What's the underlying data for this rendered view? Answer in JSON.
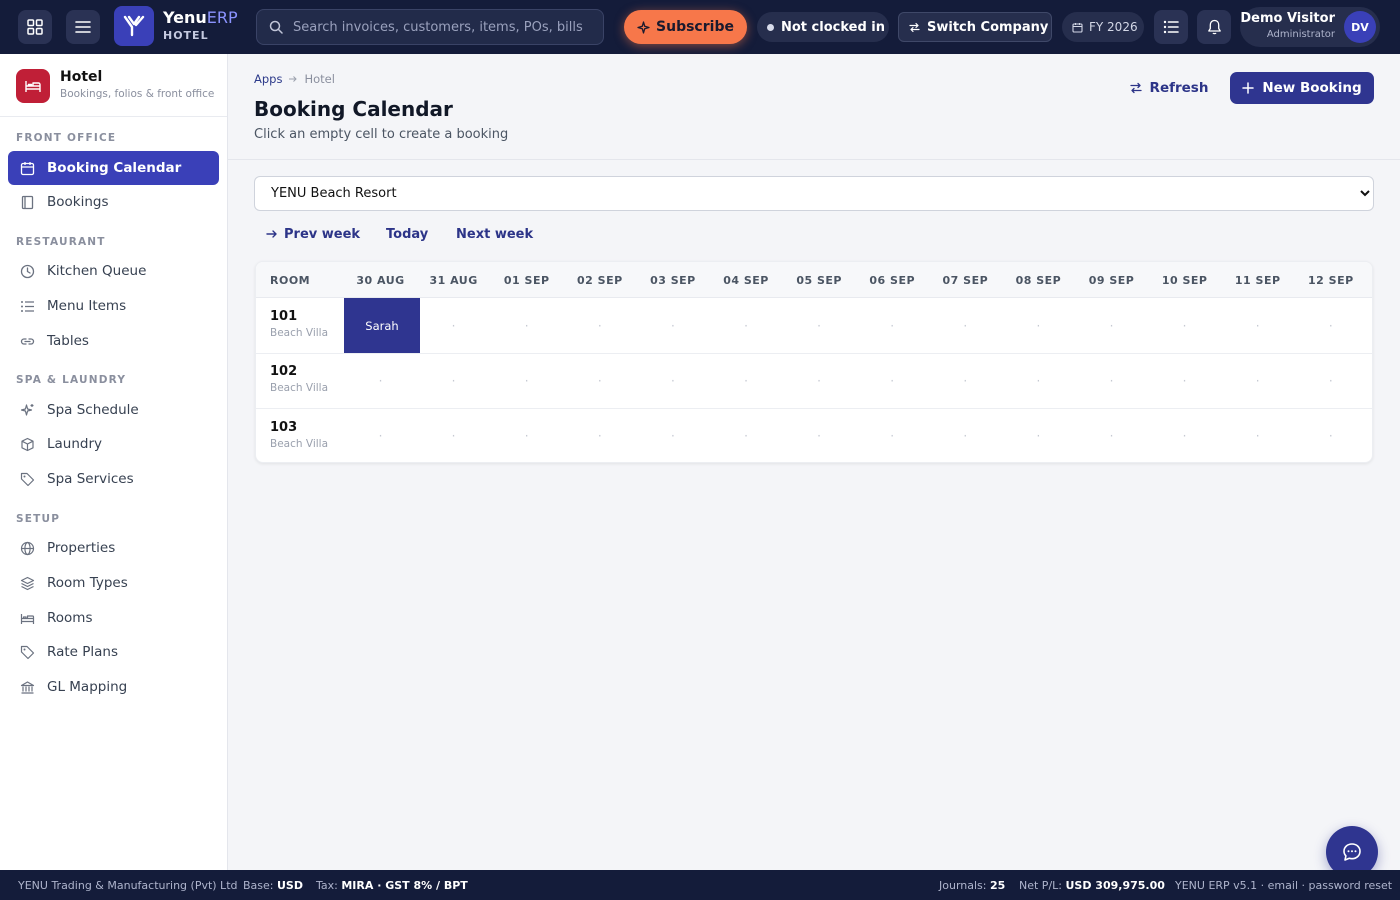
{
  "topbar": {
    "brand_name": "Yenu",
    "brand_accent": "ERP",
    "brand_sub": "HOTEL",
    "search_placeholder": "Search invoices, customers, items, POs, bills…",
    "subscribe_label": "Subscribe",
    "clock_status": "Not clocked in",
    "switch_company_label": "Switch Company",
    "fiscal_year": "FY 2026",
    "user_name": "Demo Visitor",
    "user_role": "Administrator",
    "user_initials": "DV"
  },
  "sidebar": {
    "module_title": "Hotel",
    "module_subtitle": "Bookings, folios & front office",
    "sections": {
      "front_office": "FRONT OFFICE",
      "restaurant": "RESTAURANT",
      "spa_laundry": "SPA & LAUNDRY",
      "setup": "SETUP"
    },
    "items": {
      "booking_calendar": "Booking Calendar",
      "bookings": "Bookings",
      "kitchen_queue": "Kitchen Queue",
      "menu_items": "Menu Items",
      "tables": "Tables",
      "spa_schedule": "Spa Schedule",
      "laundry": "Laundry",
      "spa_services": "Spa Services",
      "properties": "Properties",
      "room_types": "Room Types",
      "rooms": "Rooms",
      "rate_plans": "Rate Plans",
      "gl_mapping": "GL Mapping"
    }
  },
  "main": {
    "breadcrumb": [
      "Apps",
      "Hotel"
    ],
    "title": "Booking Calendar",
    "subtitle": "Click an empty cell to create a booking",
    "refresh_label": "Refresh",
    "new_booking_label": "New Booking",
    "property_selected": "YENU Beach Resort",
    "prev_week": "Prev week",
    "today": "Today",
    "next_week": "Next week"
  },
  "calendar": {
    "room_header": "ROOM",
    "dates": [
      "30 AUG",
      "31 AUG",
      "01 SEP",
      "02 SEP",
      "03 SEP",
      "04 SEP",
      "05 SEP",
      "06 SEP",
      "07 SEP",
      "08 SEP",
      "09 SEP",
      "10 SEP",
      "11 SEP",
      "12 SEP"
    ],
    "empty_marker": "·",
    "rooms": [
      {
        "number": "101",
        "type": "Beach Villa"
      },
      {
        "number": "102",
        "type": "Beach Villa"
      },
      {
        "number": "103",
        "type": "Beach Villa"
      }
    ],
    "bookings": [
      {
        "room": "101",
        "date": "30 AUG",
        "guest": "Sarah"
      }
    ]
  },
  "footer": {
    "company": "YENU Trading & Manufacturing (Pvt) Ltd",
    "base_label": "Base:",
    "base_value": "USD",
    "tax_label": "Tax:",
    "tax_value": "MIRA · GST 8% / BPT",
    "journals_label": "Journals:",
    "journals_value": "25",
    "netpl_label": "Net P/L:",
    "netpl_value": "USD 309,975.00",
    "version": "YENU ERP v5.1 · email · password reset"
  },
  "colors": {
    "navy": "#141c3a",
    "primary": "#2f3590",
    "accent": "#3a40b8",
    "subscribe": "#f7774a",
    "hotel_icon": "#c01f37"
  }
}
